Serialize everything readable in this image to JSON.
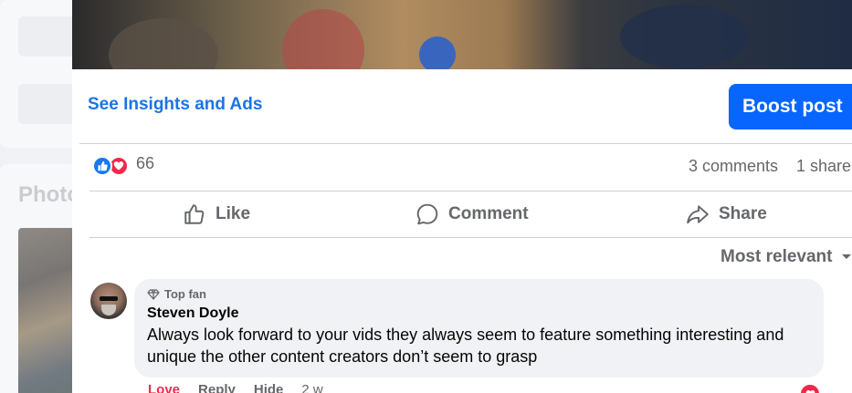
{
  "background": {
    "photos_title": "Photo"
  },
  "post": {
    "insights_link": "See Insights and Ads",
    "boost_button": "Boost post",
    "reactions": {
      "count": "66",
      "types": [
        "like",
        "love"
      ]
    },
    "comments_count": "3 comments",
    "shares_count": "1 share",
    "actions": {
      "like": "Like",
      "comment": "Comment",
      "share": "Share"
    },
    "sort_label": "Most relevant"
  },
  "comment": {
    "badge": "Top fan",
    "author": "Steven Doyle",
    "text": "Always look forward to your vids they always seem to feature something interesting and unique the other content creators don’t seem to grasp",
    "actions": {
      "love": "Love",
      "reply": "Reply",
      "hide": "Hide",
      "time": "2 w"
    }
  },
  "colors": {
    "accent": "#1b74e4",
    "boost_bg": "#0866ff",
    "love": "#f02849",
    "like": "#1877f2",
    "muted_text": "#65676b"
  },
  "icons": [
    "like-reaction-icon",
    "love-reaction-icon",
    "thumbs-up-icon",
    "comment-icon",
    "share-icon",
    "chevron-down-icon",
    "diamond-icon"
  ]
}
